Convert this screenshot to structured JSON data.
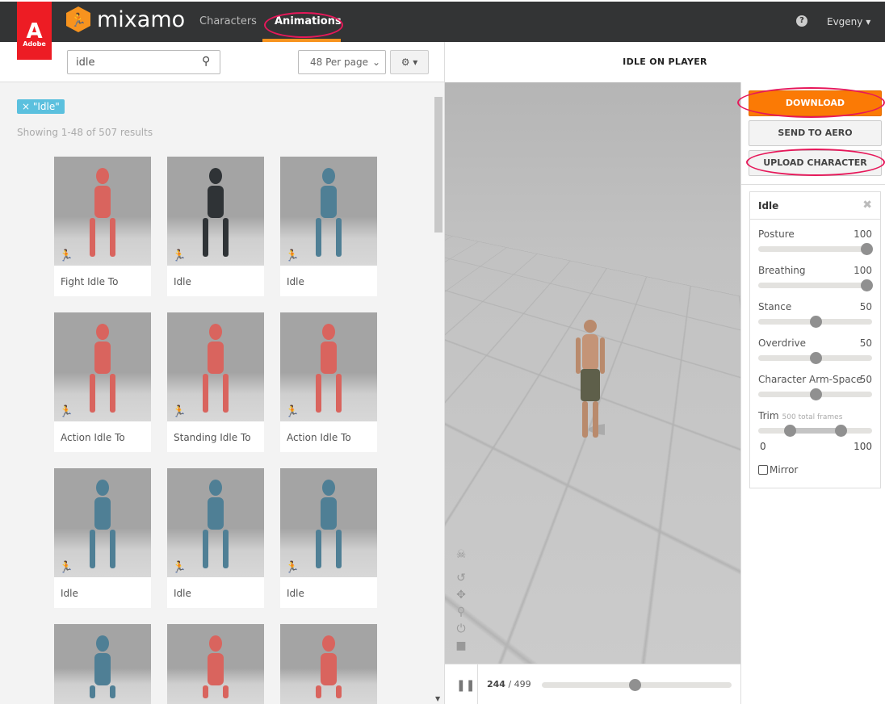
{
  "header": {
    "brand_logo": "Adobe",
    "app_name": "mixamo",
    "nav": [
      {
        "label": "Characters",
        "active": false
      },
      {
        "label": "Animations",
        "active": true
      }
    ],
    "help_icon": "?",
    "user": "Evgeny",
    "accent": "#f7931e"
  },
  "search": {
    "value": "idle",
    "per_page": "48 Per page"
  },
  "filter": {
    "tag": "× \"Idle\"",
    "results": "Showing 1-48 of 507 results"
  },
  "cards": [
    {
      "label": "Fight Idle To",
      "color": "#d9645e"
    },
    {
      "label": "Idle",
      "color": "#2f3336"
    },
    {
      "label": "Idle",
      "color": "#4f7f95"
    },
    {
      "label": "Action Idle To",
      "color": "#d9645e"
    },
    {
      "label": "Standing Idle To",
      "color": "#d9645e"
    },
    {
      "label": "Action Idle To",
      "color": "#d9645e"
    },
    {
      "label": "Idle",
      "color": "#4f7f95"
    },
    {
      "label": "Idle",
      "color": "#4f7f95"
    },
    {
      "label": "Idle",
      "color": "#4f7f95"
    },
    {
      "label": "",
      "color": "#4f7f95"
    },
    {
      "label": "",
      "color": "#d9645e"
    },
    {
      "label": "",
      "color": "#d9645e"
    }
  ],
  "player": {
    "title": "IDLE ON PLAYER",
    "current_frame": "244",
    "total_frames": "/ 499",
    "progress": 0.49
  },
  "actions": {
    "download": "DOWNLOAD",
    "send": "SEND TO AERO",
    "upload": "UPLOAD CHARACTER",
    "download_color": "#fb7a05"
  },
  "panel": {
    "title": "Idle",
    "params": [
      {
        "name": "Posture",
        "value": "100",
        "fraction": 1.0
      },
      {
        "name": "Breathing",
        "value": "100",
        "fraction": 1.0
      },
      {
        "name": "Stance",
        "value": "50",
        "fraction": 0.5
      },
      {
        "name": "Overdrive",
        "value": "50",
        "fraction": 0.5
      },
      {
        "name": "Character Arm-Space",
        "value": "50",
        "fraction": 0.5
      }
    ],
    "trim": {
      "label": "Trim",
      "sub": "500 total frames",
      "min": "0",
      "max": "100",
      "start_fraction": 0.28,
      "end_fraction": 0.72
    },
    "mirror": "Mirror"
  }
}
